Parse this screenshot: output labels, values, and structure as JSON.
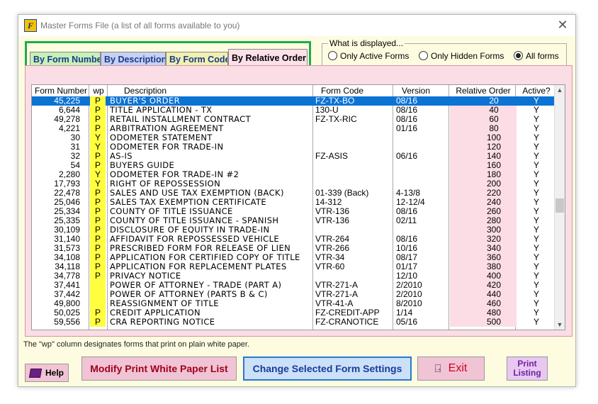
{
  "window": {
    "title": "Master Forms File (a list of all forms available to you)"
  },
  "tabs": [
    {
      "label": "By Form Number"
    },
    {
      "label": "By Description"
    },
    {
      "label": "By Form Code"
    },
    {
      "label": "By Relative Order",
      "selected": true
    }
  ],
  "display_group": {
    "label": "What is displayed...",
    "options": [
      {
        "label": "Only Active Forms",
        "checked": false
      },
      {
        "label": "Only Hidden Forms",
        "checked": false
      },
      {
        "label": "All forms",
        "checked": true
      }
    ]
  },
  "table": {
    "columns": [
      "Form Number",
      "wp",
      "Description",
      "Form Code",
      "Version",
      "Relative Order",
      "Active?"
    ],
    "rows": [
      {
        "num": "45,225",
        "wp": "P",
        "desc": "BUYER'S ORDER",
        "code": "FZ-TX-BO",
        "ver": "08/16",
        "ord": "20",
        "act": "Y",
        "selected": true
      },
      {
        "num": "6,644",
        "wp": "P",
        "desc": "TITLE APPLICATION - TX",
        "code": "130-U",
        "ver": "08/16",
        "ord": "40",
        "act": "Y"
      },
      {
        "num": "49,278",
        "wp": "P",
        "desc": "RETAIL INSTALLMENT CONTRACT",
        "code": "FZ-TX-RIC",
        "ver": "08/16",
        "ord": "60",
        "act": "Y"
      },
      {
        "num": "4,221",
        "wp": "P",
        "desc": "ARBITRATION AGREEMENT",
        "code": "",
        "ver": "01/16",
        "ord": "80",
        "act": "Y"
      },
      {
        "num": "30",
        "wp": "Y",
        "desc": "ODOMETER STATEMENT",
        "code": "",
        "ver": "",
        "ord": "100",
        "act": "Y"
      },
      {
        "num": "31",
        "wp": "Y",
        "desc": "ODOMETER FOR TRADE-IN",
        "code": "",
        "ver": "",
        "ord": "120",
        "act": "Y"
      },
      {
        "num": "32",
        "wp": "P",
        "desc": "AS-IS",
        "code": "FZ-ASIS",
        "ver": "06/16",
        "ord": "140",
        "act": "Y"
      },
      {
        "num": "54",
        "wp": "P",
        "desc": "BUYERS GUIDE",
        "code": "",
        "ver": "",
        "ord": "160",
        "act": "Y"
      },
      {
        "num": "2,280",
        "wp": "Y",
        "desc": "ODOMETER FOR TRADE-IN #2",
        "code": "",
        "ver": "",
        "ord": "180",
        "act": "Y"
      },
      {
        "num": "17,793",
        "wp": "Y",
        "desc": "RIGHT OF REPOSSESSION",
        "code": "",
        "ver": "",
        "ord": "200",
        "act": "Y"
      },
      {
        "num": "22,478",
        "wp": "P",
        "desc": "SALES AND USE TAX EXEMPTION (BACK)",
        "code": "01-339 (Back)",
        "ver": "4-13/8",
        "ord": "220",
        "act": "Y"
      },
      {
        "num": "25,046",
        "wp": "P",
        "desc": "SALES TAX EXEMPTION CERTIFICATE",
        "code": "14-312",
        "ver": "12-12/4",
        "ord": "240",
        "act": "Y"
      },
      {
        "num": "25,334",
        "wp": "P",
        "desc": "COUNTY OF TITLE ISSUANCE",
        "code": "VTR-136",
        "ver": "08/16",
        "ord": "260",
        "act": "Y"
      },
      {
        "num": "25,335",
        "wp": "P",
        "desc": "COUNTY OF TITLE ISSUANCE - SPANISH",
        "code": "VTR-136",
        "ver": "02/11",
        "ord": "280",
        "act": "Y"
      },
      {
        "num": "30,109",
        "wp": "P",
        "desc": "DISCLOSURE OF EQUITY IN TRADE-IN",
        "code": "",
        "ver": "",
        "ord": "300",
        "act": "Y"
      },
      {
        "num": "31,140",
        "wp": "P",
        "desc": "AFFIDAVIT FOR REPOSSESSED VEHICLE",
        "code": "VTR-264",
        "ver": "08/16",
        "ord": "320",
        "act": "Y"
      },
      {
        "num": "31,573",
        "wp": "P",
        "desc": "PRESCRIBED FORM FOR RELEASE OF LIEN",
        "code": "VTR-266",
        "ver": "10/16",
        "ord": "340",
        "act": "Y"
      },
      {
        "num": "34,108",
        "wp": "P",
        "desc": "APPLICATION FOR CERTIFIED COPY OF TITLE",
        "code": "VTR-34",
        "ver": "08/17",
        "ord": "360",
        "act": "Y"
      },
      {
        "num": "34,118",
        "wp": "P",
        "desc": "APPLICATION FOR REPLACEMENT PLATES",
        "code": "VTR-60",
        "ver": "01/17",
        "ord": "380",
        "act": "Y"
      },
      {
        "num": "34,778",
        "wp": "P",
        "desc": "PRIVACY NOTICE",
        "code": "",
        "ver": "12/10",
        "ord": "400",
        "act": "Y"
      },
      {
        "num": "37,441",
        "wp": "",
        "desc": "POWER OF ATTORNEY - TRADE (PART A)",
        "code": "VTR-271-A",
        "ver": "2/2010",
        "ord": "420",
        "act": "Y"
      },
      {
        "num": "37,442",
        "wp": "",
        "desc": "POWER OF ATTORNEY (PARTS B & C)",
        "code": "VTR-271-A",
        "ver": "2/2010",
        "ord": "440",
        "act": "Y"
      },
      {
        "num": "49,800",
        "wp": "",
        "desc": "REASSIGNMENT OF TITLE",
        "code": "VTR-41-A",
        "ver": "8/2010",
        "ord": "460",
        "act": "Y"
      },
      {
        "num": "50,025",
        "wp": "P",
        "desc": "CREDIT APPLICATION",
        "code": "FZ-CREDIT-APP",
        "ver": "1/14",
        "ord": "480",
        "act": "Y"
      },
      {
        "num": "59,556",
        "wp": "P",
        "desc": "CRA REPORTING NOTICE",
        "code": "FZ-CRANOTICE",
        "ver": "05/16",
        "ord": "500",
        "act": "Y"
      }
    ]
  },
  "footnote": "The \"wp\" column designates forms that print on plain white paper.",
  "buttons": {
    "help": "Help",
    "modify": "Modify Print White Paper List",
    "change": "Change Selected Form Settings",
    "exit": "Exit",
    "print_line1": "Print",
    "print_line2": "Listing"
  },
  "icons": [
    "app-icon",
    "close-icon",
    "book-icon",
    "exit-door-icon",
    "scroll-up-icon",
    "scroll-down-icon"
  ]
}
